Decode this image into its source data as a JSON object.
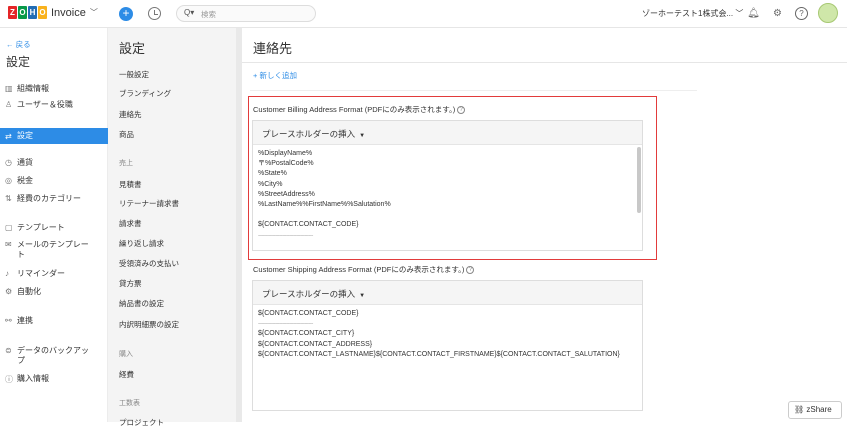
{
  "topbar": {
    "logo_letters": [
      "Z",
      "O",
      "H",
      "O"
    ],
    "logo_colors": [
      "#e42527",
      "#089949",
      "#226db4",
      "#f9b21d"
    ],
    "app_name": "Invoice",
    "search_prefix": "Q▾",
    "search_placeholder": "検索",
    "org_name": "ゾーホーテスト1株式会...",
    "icons": [
      "plus-icon",
      "clock-icon",
      "search-icon",
      "bell-icon",
      "gear-icon",
      "help-icon",
      "avatar"
    ]
  },
  "leftnav": {
    "back": "← 戻る",
    "title": "設定",
    "items": [
      {
        "icon": "▥",
        "label": "組織情報"
      },
      {
        "icon": "♙",
        "label": "ユーザー＆役職"
      },
      {
        "icon": "⇄",
        "label": "設定",
        "active": true
      },
      {
        "icon": "◷",
        "label": "通貨"
      },
      {
        "icon": "◎",
        "label": "税金"
      },
      {
        "icon": "⇅",
        "label": "経費のカテゴリー"
      },
      {
        "icon": "▢",
        "label": "テンプレート"
      },
      {
        "icon": "✉",
        "label": "メールのテンプレー",
        "label2": "ト"
      },
      {
        "icon": "♪",
        "label": "リマインダー"
      },
      {
        "icon": "⚙",
        "label": "自動化"
      },
      {
        "icon": "⚯",
        "label": "連携"
      },
      {
        "icon": "⊜",
        "label": "データのバックアッ",
        "label2": "プ"
      },
      {
        "icon": "ⓘ",
        "label": "購入情報"
      }
    ]
  },
  "midnav": {
    "title": "設定",
    "items": [
      {
        "label": "一般設定",
        "type": "item"
      },
      {
        "label": "ブランディング",
        "type": "item"
      },
      {
        "label": "連絡先",
        "type": "item",
        "active": true
      },
      {
        "label": "商品",
        "type": "item"
      },
      {
        "label": "売上",
        "type": "section"
      },
      {
        "label": "見積書",
        "type": "item"
      },
      {
        "label": "リテーナー請求書",
        "type": "item"
      },
      {
        "label": "請求書",
        "type": "item"
      },
      {
        "label": "繰り返し請求",
        "type": "item"
      },
      {
        "label": "受領済みの支払い",
        "type": "item"
      },
      {
        "label": "貸方票",
        "type": "item"
      },
      {
        "label": "納品書の設定",
        "type": "item"
      },
      {
        "label": "内訳明細票の設定",
        "type": "item"
      },
      {
        "label": "購入",
        "type": "section"
      },
      {
        "label": "経費",
        "type": "item"
      },
      {
        "label": "工数表",
        "type": "section"
      },
      {
        "label": "プロジェクト",
        "type": "item"
      }
    ]
  },
  "main": {
    "title": "連絡先",
    "add_new": "+ 新しく追加",
    "billing": {
      "label": "Customer Billing Address Format (PDFにのみ表示されます。)",
      "insert_placeholder": "プレースホルダーの挿入",
      "lines": [
        "%DisplayName%",
        "〒%PostalCode%",
        "%State%",
        "%City%",
        "%StreetAddress%",
        "%LastName%%FirstName%%Salutation%",
        "",
        "${CONTACT.CONTACT_CODE}",
        "-----------------------------------------------"
      ]
    },
    "shipping": {
      "label": "Customer Shipping Address Format (PDFにのみ表示されます。)",
      "insert_placeholder": "プレースホルダーの挿入",
      "lines": [
        "${CONTACT.CONTACT_CODE}",
        "-----------------------------------------------",
        "${CONTACT.CONTACT_CITY}",
        "${CONTACT.CONTACT_ADDRESS}",
        "${CONTACT.CONTACT_LASTNAME}${CONTACT.CONTACT_FIRSTNAME}${CONTACT.CONTACT_SALUTATION}"
      ]
    }
  },
  "zshare": "zShare",
  "colors": {
    "accent": "#2d8ce6",
    "highlight_border": "#e23b3b"
  }
}
